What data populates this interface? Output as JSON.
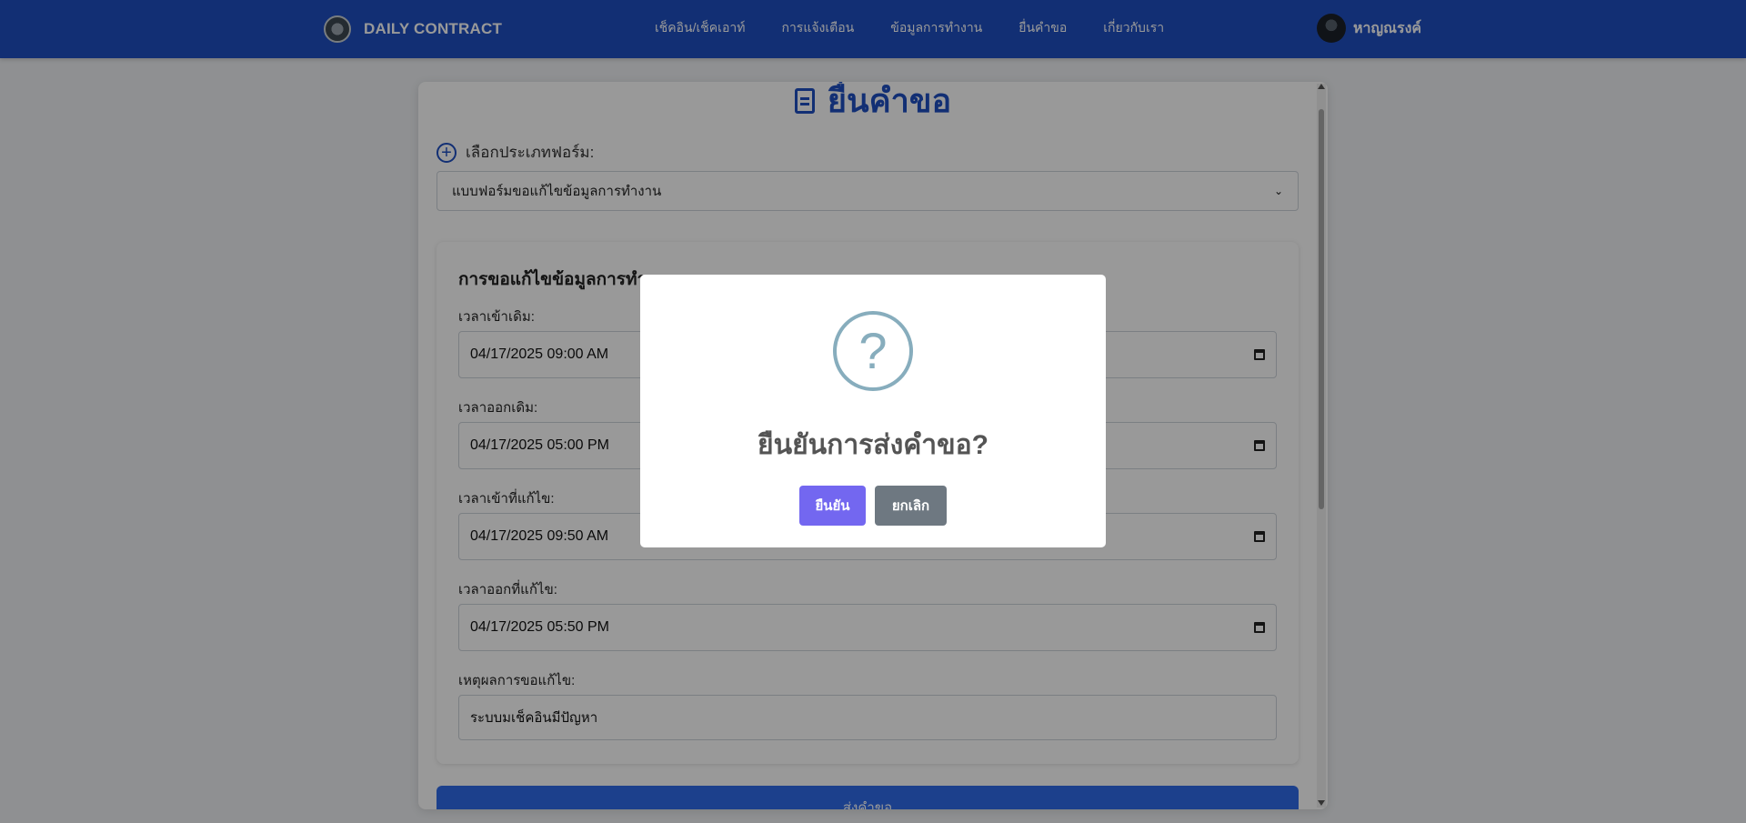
{
  "navbar": {
    "brand": "DAILY CONTRACT",
    "links": [
      "เช็คอิน/เช็คเอาท์",
      "การแจ้งเตือน",
      "ข้อมูลการทำงาน",
      "ยื่นคำขอ",
      "เกี่ยวกับเรา"
    ],
    "user_name": "หาญณรงค์"
  },
  "page": {
    "title": "ยื่นคำขอ",
    "form_type_label": "เลือกประเภทฟอร์ม:",
    "form_type_value": "แบบฟอร์มขอแก้ไขข้อมูลการทำงาน"
  },
  "form": {
    "title": "การขอแก้ไขข้อมูลการทำงาน",
    "fields": [
      {
        "label": "เวลาเข้าเดิม:",
        "value": "04/17/2025 09:00 AM"
      },
      {
        "label": "เวลาออกเดิม:",
        "value": "04/17/2025 05:00 PM"
      },
      {
        "label": "เวลาเข้าที่แก้ไข:",
        "value": "04/17/2025 09:50 AM"
      },
      {
        "label": "เวลาออกที่แก้ไข:",
        "value": "04/17/2025 05:50 PM"
      }
    ],
    "reason_label": "เหตุผลการขอแก้ไข:",
    "reason_value": "ระบบมเช็คอินมีปัญหา",
    "submit_label": "ส่งคำขอ"
  },
  "modal": {
    "icon": "?",
    "title": "ยืนยันการส่งคำขอ?",
    "confirm_label": "ยืนยัน",
    "cancel_label": "ยกเลิก"
  },
  "colors": {
    "navbar": "#1e4fc2",
    "confirm": "#7367f0",
    "cancel": "#6e7881",
    "question_icon": "#87adbd",
    "submit": "#2f6bea"
  }
}
